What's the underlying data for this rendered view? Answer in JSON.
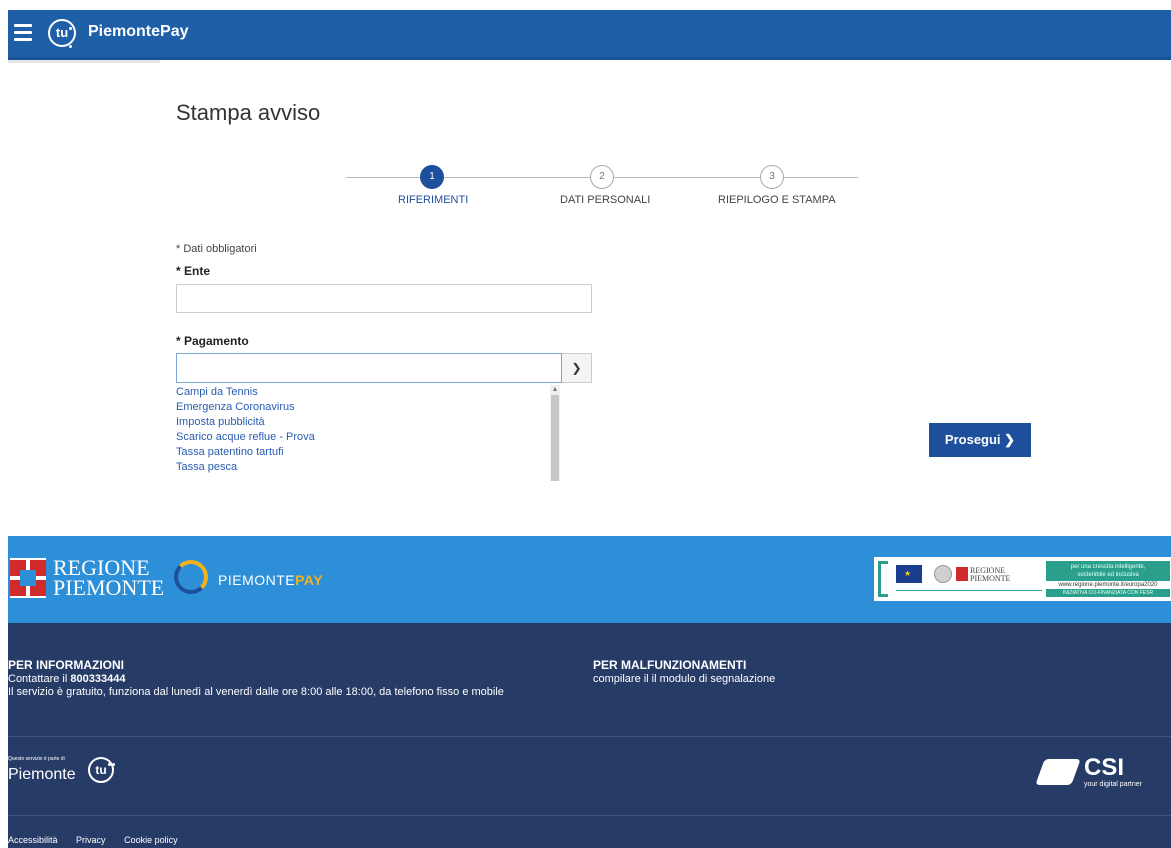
{
  "header": {
    "brand": "PiemontePay",
    "logo_text": "tu",
    "menu_icon": "hamburger-icon"
  },
  "page": {
    "title": "Stampa avviso"
  },
  "stepper": {
    "steps": [
      {
        "number": "1",
        "label": "RIFERIMENTI",
        "state": "active"
      },
      {
        "number": "2",
        "label": "DATI PERSONALI",
        "state": "inactive"
      },
      {
        "number": "3",
        "label": "RIEPILOGO E STAMPA",
        "state": "inactive"
      }
    ]
  },
  "form": {
    "required_note": "* Dati obbligatori",
    "ente_label": "* Ente",
    "ente_value": "",
    "pagamento_label": "* Pagamento",
    "pagamento_value": "",
    "pagamento_options": [
      "Campi da Tennis",
      "Emergenza Coronavirus",
      "Imposta pubblicità",
      "Scarico acque reflue - Prova",
      "Tassa patentino tartufi",
      "Tassa pesca"
    ],
    "submit_label": "Prosegui ❯"
  },
  "footer": {
    "regione_line1": "REGIONE",
    "regione_line2": "PIEMONTE",
    "piemontepay_part1": "PIEMONTE",
    "piemontepay_part2": "PAY",
    "eu_banner": {
      "line1": "per una crescita intelligente,",
      "line2": "sostenibile ed inclusiva",
      "url": "www.regione.piemonte.it/europa2020",
      "note": "INIZIATIVA CO-FINANZIATA CON FESR",
      "regione_mini": "REGIONE PIEMONTE"
    },
    "info_title": "PER INFORMAZIONI",
    "info_contact_prefix": "Contattare il ",
    "info_phone": "800333444",
    "info_text": "Il servizio è gratuito, funziona dal lunedì al venerdì dalle ore 8:00 alle 18:00, da telefono fisso e mobile",
    "malf_title": "PER MALFUNZIONAMENTI",
    "malf_text": "compilare il il modulo di segnalazione",
    "pt_small": "Questo servizio è parte di",
    "pt_name": "Piemonte",
    "pt_logo_text": "tu",
    "csi_name": "CSI",
    "csi_tagline": "your digital partner",
    "links": [
      "Accessibilità",
      "Privacy",
      "Cookie policy"
    ],
    "colors": {
      "header_blue": "#1e5fa8",
      "band_blue": "#2e8fd9",
      "footer_navy": "#263b66",
      "accent_navy": "#1e4f9c",
      "pay_yellow": "#f3b21b"
    }
  }
}
